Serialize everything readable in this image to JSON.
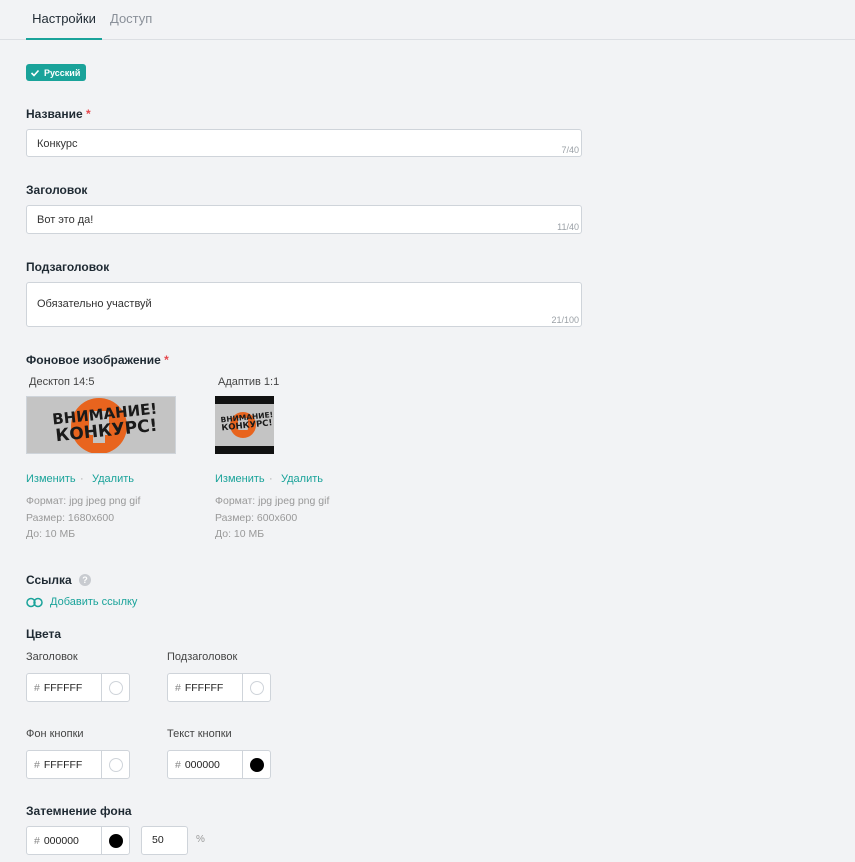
{
  "tabs": [
    {
      "label": "Настройки",
      "active": true
    },
    {
      "label": "Доступ",
      "active": false
    }
  ],
  "language_badge": "Русский",
  "name": {
    "label": "Название",
    "required_mark": "*",
    "value": "Конкурс",
    "counter": "7/40"
  },
  "heading": {
    "label": "Заголовок",
    "value": "Вот это да!",
    "counter": "11/40"
  },
  "subheading": {
    "label": "Подзаголовок",
    "value": "Обязательно участвуй",
    "counter": "21/100"
  },
  "background_image": {
    "label": "Фоновое изображение",
    "required_mark": "*",
    "desktop": {
      "title": "Десктоп 14:5",
      "change": "Изменить",
      "separator": "·",
      "remove": "Удалить",
      "format": "Формат: jpg  jpeg  png  gif",
      "size": "Размер: 1680x600",
      "max": "До: 10 МБ"
    },
    "adaptive": {
      "title": "Адаптив 1:1",
      "change": "Изменить",
      "separator": "·",
      "remove": "Удалить",
      "format": "Формат: jpg  jpeg  png  gif",
      "size": "Размер: 600x600",
      "max": "До: 10 МБ"
    },
    "banner_line1": "ВНИМАНИЕ!",
    "banner_line2": "КОНКУРС!"
  },
  "link": {
    "label": "Ссылка",
    "help": "?",
    "add_label": "Добавить ссылку"
  },
  "colors": {
    "label": "Цвета",
    "hash": "#",
    "heading": {
      "label": "Заголовок",
      "value": "FFFFFF",
      "color": "#FFFFFF"
    },
    "subheading": {
      "label": "Подзаголовок",
      "value": "FFFFFF",
      "color": "#FFFFFF"
    },
    "button_bg": {
      "label": "Фон кнопки",
      "value": "FFFFFF",
      "color": "#FFFFFF"
    },
    "button_text": {
      "label": "Текст кнопки",
      "value": "000000",
      "color": "#000000"
    }
  },
  "dimming": {
    "label": "Затемнение фона",
    "hash": "#",
    "value": "000000",
    "color": "#000000",
    "opacity": "50",
    "unit": "%"
  }
}
